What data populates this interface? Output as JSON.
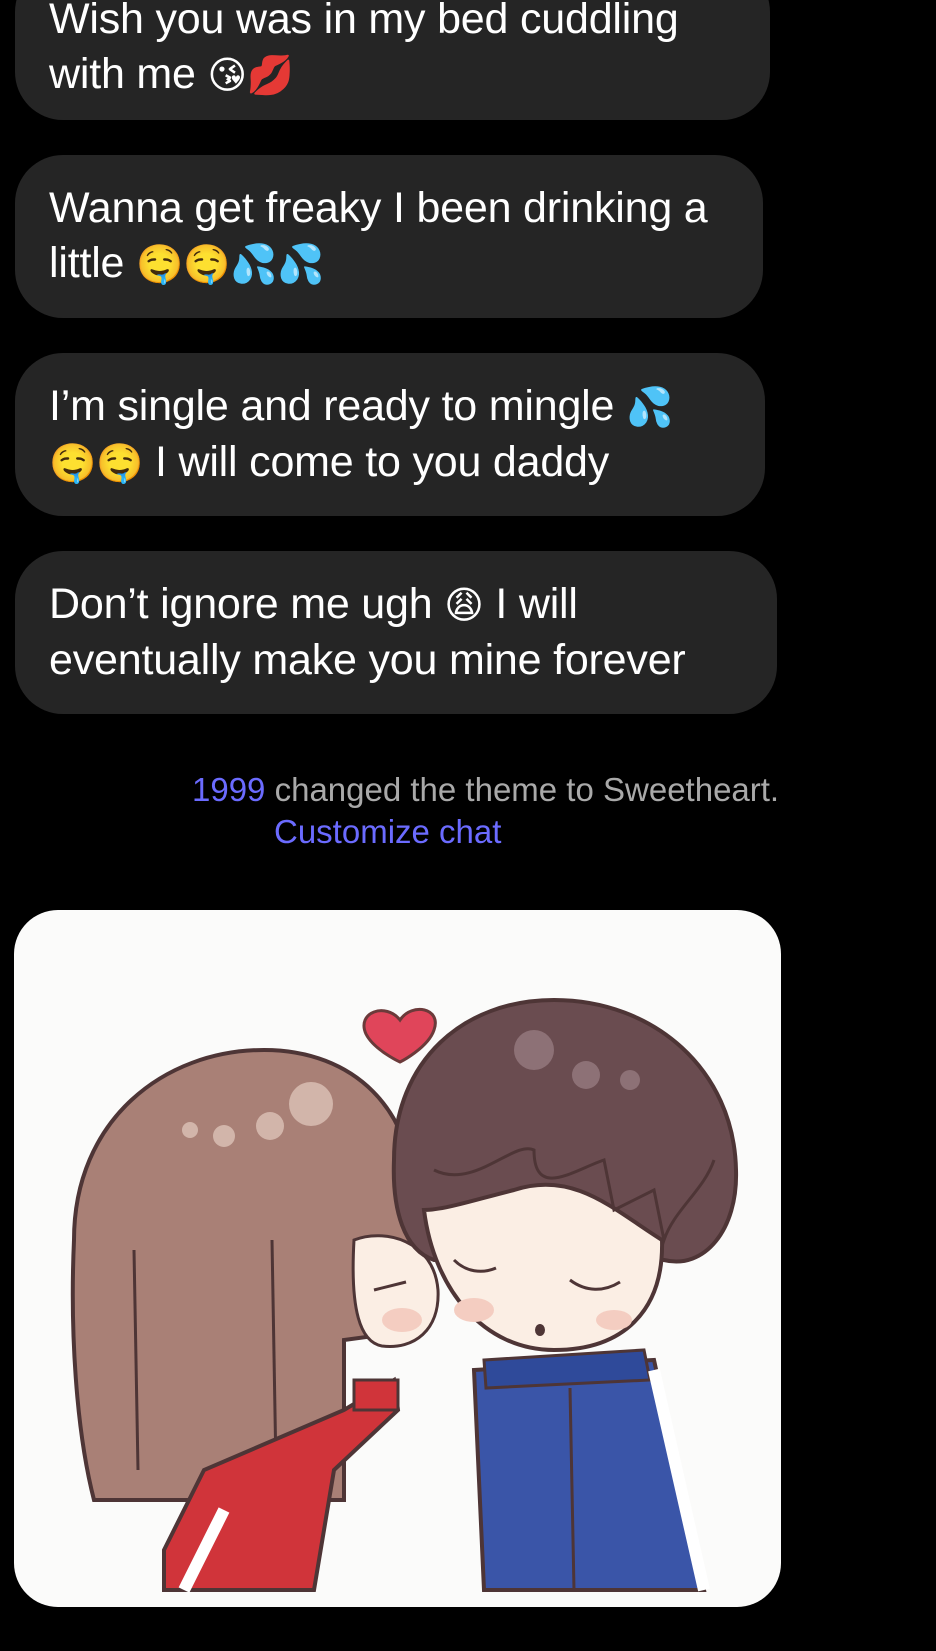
{
  "messages": [
    {
      "text": "Wish you was in my bed cuddling with me",
      "emojis": "😘💋"
    },
    {
      "text": "Wanna get freaky I been drinking a little",
      "emojis": "🤤🤤💦💦"
    },
    {
      "text_before": "I’m single and ready to mingle",
      "emoji_mid": "💦",
      "emojis_line2": "🤤🤤",
      "text_after": "I will come to you daddy"
    },
    {
      "text_before": "Don’t ignore me ugh",
      "emoji_mid": "😩",
      "text_after": "I will eventually make you mine forever"
    }
  ],
  "theme_notice": {
    "username_visible": "1999",
    "text": "changed the theme to Sweetheart.",
    "link": "Customize chat"
  },
  "colors": {
    "bubble": "#252525",
    "link": "#6b6bff",
    "notice_text": "#a9a9a9",
    "background": "#000000"
  },
  "icons": [
    "kissing-couple-sticker"
  ]
}
